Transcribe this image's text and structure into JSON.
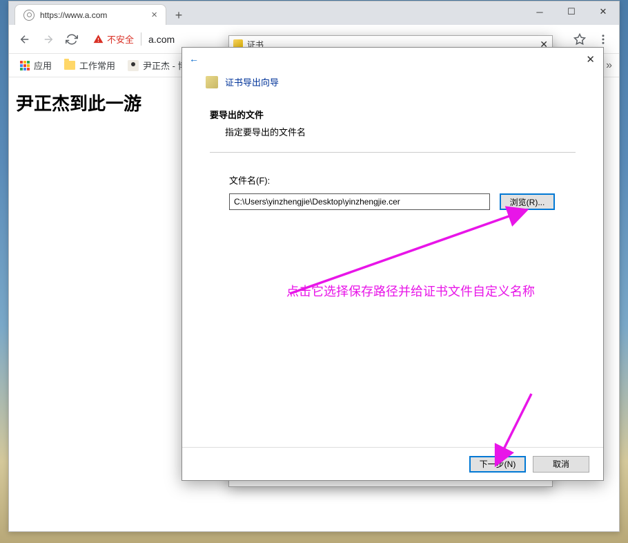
{
  "browser": {
    "tab_title": "https://www.a.com",
    "url_display": "a.com",
    "security_warning": "不安全",
    "bookmarks": {
      "apps_label": "应用",
      "folder_label": "工作常用",
      "bookmark1_label": "尹正杰 - 博"
    }
  },
  "page": {
    "heading": "尹正杰到此一游"
  },
  "cert_bg_dialog": {
    "title": "证书"
  },
  "wizard": {
    "title": "证书导出向导",
    "section_title": "要导出的文件",
    "section_sub": "指定要导出的文件名",
    "filename_label": "文件名(F):",
    "filename_value": "C:\\Users\\yinzhengjie\\Desktop\\yinzhengjie.cer",
    "browse_label": "浏览(R)...",
    "next_label": "下一步(N)",
    "cancel_label": "取消"
  },
  "annotations": {
    "browse_hint": "点击它选择保存路径并给证书文件自定义名称"
  }
}
